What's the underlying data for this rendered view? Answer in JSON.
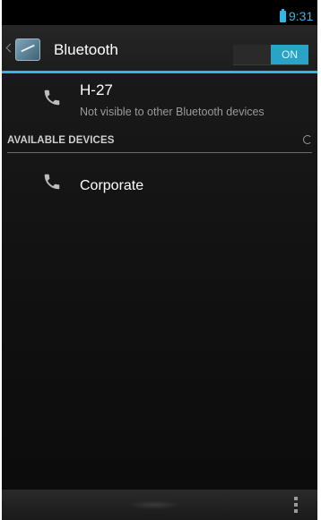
{
  "status_bar": {
    "time": "9:31",
    "battery_color": "#33b5e5"
  },
  "action_bar": {
    "title": "Bluetooth",
    "toggle_label": "ON",
    "accent_color": "#33b5e5"
  },
  "paired_device": {
    "name": "H-27",
    "status": "Not visible to other Bluetooth devices",
    "icon": "phone-icon"
  },
  "available_devices": {
    "header": "AVAILABLE DEVICES",
    "items": [
      {
        "name": "Corporate",
        "icon": "phone-icon"
      }
    ]
  }
}
